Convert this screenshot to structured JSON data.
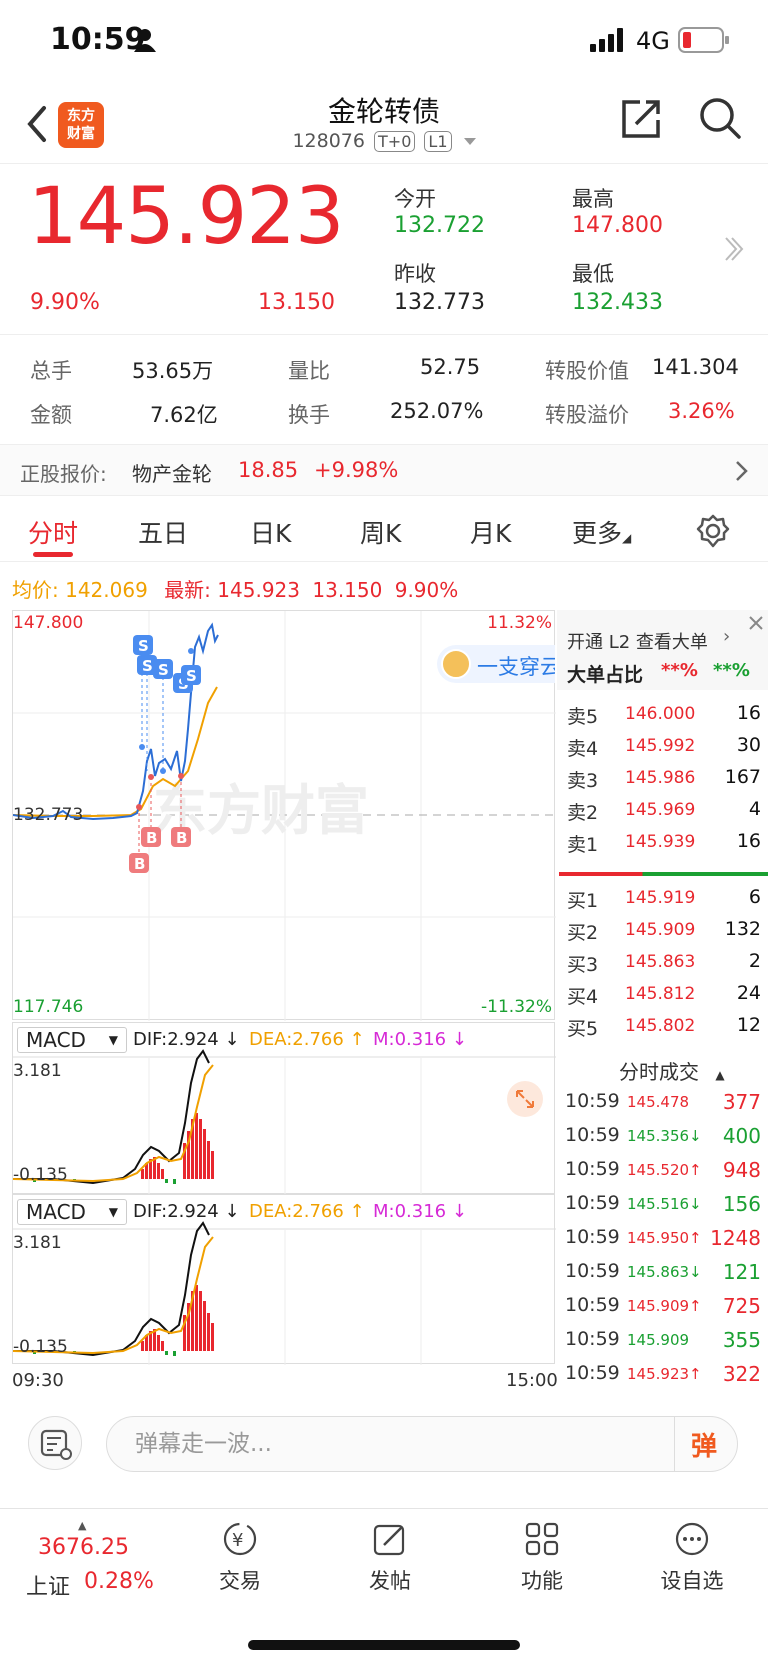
{
  "status": {
    "time": "10:59",
    "network": "4G"
  },
  "nav": {
    "title": "金轮转债",
    "code": "128076",
    "badge1": "T+0",
    "badge2": "L1",
    "logo_text_1": "东方",
    "logo_text_2": "财富"
  },
  "quote": {
    "price": "145.923",
    "change_pct": "9.90%",
    "change": "13.150",
    "open_label": "今开",
    "open": "132.722",
    "prev_label": "昨收",
    "prev": "132.773",
    "high_label": "最高",
    "high": "147.800",
    "low_label": "最低",
    "low": "132.433"
  },
  "stats": {
    "vol_label": "总手",
    "vol": "53.65万",
    "ratio_label": "量比",
    "ratio": "52.75",
    "cv_label": "转股价值",
    "cv": "141.304",
    "amt_label": "金额",
    "amt": "7.62亿",
    "turn_label": "换手",
    "turn": "252.07%",
    "prem_label": "转股溢价",
    "prem": "3.26%"
  },
  "underlying": {
    "label": "正股报价:",
    "name": "物产金轮",
    "price": "18.85",
    "change": "+9.98%"
  },
  "tabs": [
    "分时",
    "五日",
    "日K",
    "周K",
    "月K",
    "更多"
  ],
  "intraday": {
    "avg_label": "均价:",
    "avg": "142.069",
    "latest_label": "最新:",
    "latest": "145.923",
    "chg": "13.150",
    "pct": "9.90%",
    "y_high": "147.800",
    "y_mid": "132.773",
    "y_low": "117.746",
    "pct_high": "11.32%",
    "pct_low": "-11.32%",
    "watermark": "东方财富",
    "promo": "一支穿云",
    "time_start": "09:30",
    "time_end": "15:00",
    "b_label": "B",
    "s_label": "S"
  },
  "macd": {
    "name": "MACD",
    "dif": "DIF:2.924 ↓",
    "dea": "DEA:2.766 ↑",
    "m": "M:0.316 ↓",
    "top": "3.181",
    "bottom": "-0.135"
  },
  "l2": {
    "title": "开通 L2 查看大单",
    "ratio_label": "大单占比",
    "ratio_red": "**%",
    "ratio_green": "**%"
  },
  "orderbook": {
    "asks": [
      {
        "name": "卖5",
        "price": "146.000",
        "vol": "16"
      },
      {
        "name": "卖4",
        "price": "145.992",
        "vol": "30"
      },
      {
        "name": "卖3",
        "price": "145.986",
        "vol": "167"
      },
      {
        "name": "卖2",
        "price": "145.969",
        "vol": "4"
      },
      {
        "name": "卖1",
        "price": "145.939",
        "vol": "16"
      }
    ],
    "bids": [
      {
        "name": "买1",
        "price": "145.919",
        "vol": "6"
      },
      {
        "name": "买2",
        "price": "145.909",
        "vol": "132"
      },
      {
        "name": "买3",
        "price": "145.863",
        "vol": "2"
      },
      {
        "name": "买4",
        "price": "145.812",
        "vol": "24"
      },
      {
        "name": "买5",
        "price": "145.802",
        "vol": "12"
      }
    ]
  },
  "trades": {
    "title": "分时成交",
    "rows": [
      {
        "time": "10:59",
        "price": "145.478",
        "vol": "377",
        "color": "red"
      },
      {
        "time": "10:59",
        "price": "145.356↓",
        "vol": "400",
        "color": "green"
      },
      {
        "time": "10:59",
        "price": "145.520↑",
        "vol": "948",
        "color": "red"
      },
      {
        "time": "10:59",
        "price": "145.516↓",
        "vol": "156",
        "color": "green"
      },
      {
        "time": "10:59",
        "price": "145.950↑",
        "vol": "1248",
        "color": "red"
      },
      {
        "time": "10:59",
        "price": "145.863↓",
        "vol": "121",
        "color": "green"
      },
      {
        "time": "10:59",
        "price": "145.909↑",
        "vol": "725",
        "color": "red"
      },
      {
        "time": "10:59",
        "price": "145.909",
        "vol": "355",
        "color": "green"
      },
      {
        "time": "10:59",
        "price": "145.923↑",
        "vol": "322",
        "color": "red"
      }
    ]
  },
  "comment": {
    "placeholder": "弹幕走一波...",
    "danmu": "弹"
  },
  "bottom": {
    "index_value": "3676.25",
    "index_name": "上证",
    "index_pct": "0.28%",
    "trade": "交易",
    "post": "发帖",
    "func": "功能",
    "watch": "设自选"
  },
  "colors": {
    "red": "#e8282f",
    "green": "#1aa032",
    "orange": "#f0a000",
    "magenta": "#d62ad6",
    "blue": "#2c7be5"
  }
}
